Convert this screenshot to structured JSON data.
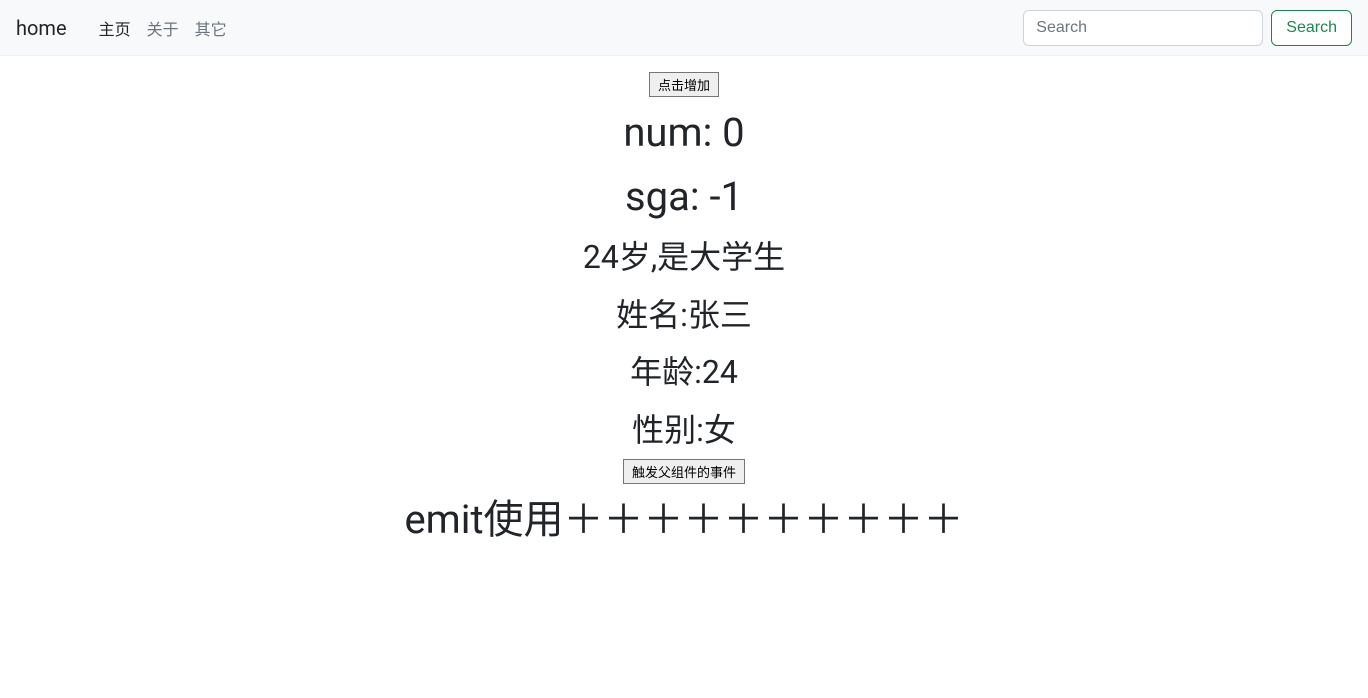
{
  "navbar": {
    "brand": "home",
    "links": [
      {
        "label": "主页",
        "active": true
      },
      {
        "label": "关于",
        "active": false
      },
      {
        "label": "其它",
        "active": false
      }
    ],
    "search_placeholder": "Search",
    "search_button": "Search"
  },
  "main": {
    "increment_button": "点击增加",
    "num_line": "num: 0",
    "sga_line": "sga: -1",
    "age_desc": "24岁,是大学生",
    "name_line": "姓名:张三",
    "age_line": "年龄:24",
    "gender_line": "性别:女",
    "emit_button": "触发父组件的事件",
    "emit_usage": "emit使用＋＋＋＋＋＋＋＋＋＋"
  }
}
